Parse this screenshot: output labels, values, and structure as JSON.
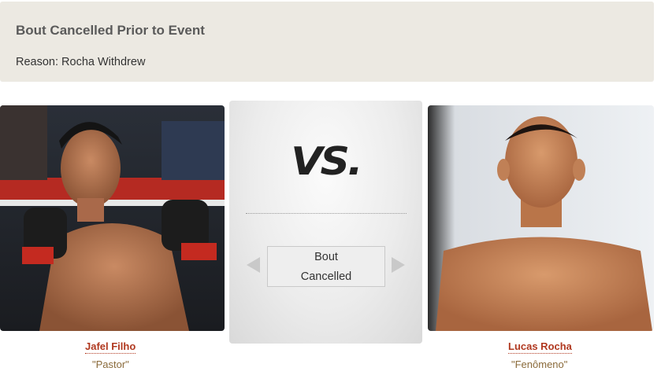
{
  "notice": {
    "title": "Bout Cancelled Prior to Event",
    "reason_label": "Reason:",
    "reason_value": "Rocha Withdrew"
  },
  "center": {
    "vs_text": "VS.",
    "status_line1": "Bout",
    "status_line2": "Cancelled",
    "prev_icon": "triangle-left",
    "next_icon": "triangle-right"
  },
  "fighters": [
    {
      "name": "Jafel Filho",
      "nickname": "\"Pastor\""
    },
    {
      "name": "Lucas Rocha",
      "nickname": "\"Fenômeno\""
    }
  ],
  "colors": {
    "notice_bg": "#ece9e2",
    "name_link": "#b0381f",
    "nickname": "#8a6a3a"
  }
}
